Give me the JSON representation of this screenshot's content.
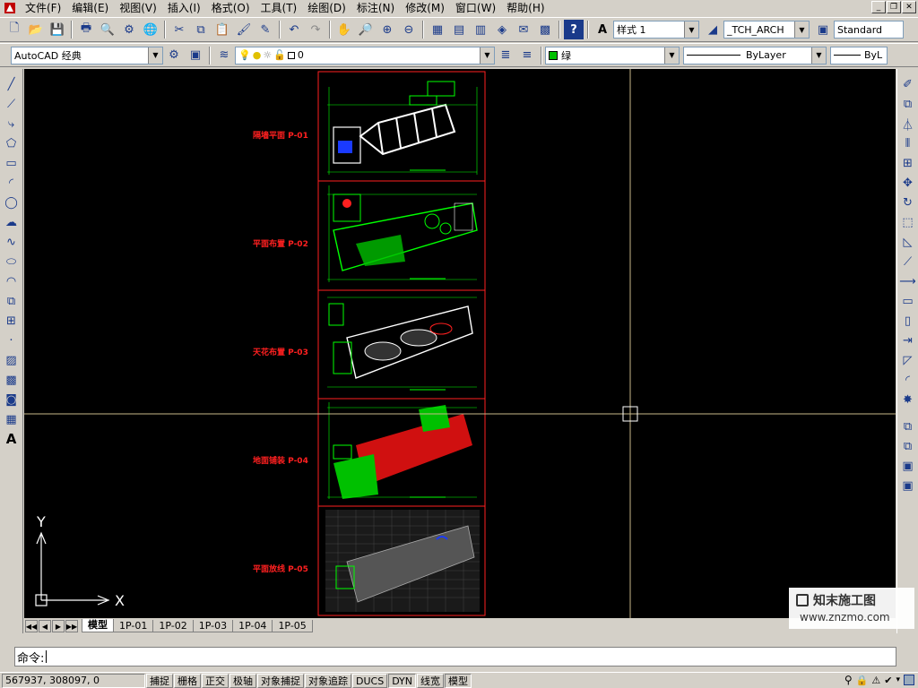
{
  "menu": {
    "items": [
      "文件(F)",
      "编辑(E)",
      "视图(V)",
      "插入(I)",
      "格式(O)",
      "工具(T)",
      "绘图(D)",
      "标注(N)",
      "修改(M)",
      "窗口(W)",
      "帮助(H)"
    ]
  },
  "toolbar1": {
    "text_style_label": "样式 1",
    "dim_style_label": "_TCH_ARCH",
    "table_style_label": "Standard"
  },
  "toolbar2": {
    "workspace": "AutoCAD 经典",
    "layer": "0",
    "color": "绿",
    "linetype": "ByLayer",
    "lineweight": "ByL",
    "colors": {
      "green_swatch": "#00c000"
    }
  },
  "drawing": {
    "sheets": [
      {
        "label": "隔墙平面 P-01"
      },
      {
        "label": "平面布置 P-02"
      },
      {
        "label": "天花布置 P-03"
      },
      {
        "label": "地面铺装 P-04"
      },
      {
        "label": "平面放线 P-05"
      }
    ],
    "ucs": {
      "x": "X",
      "y": "Y"
    }
  },
  "layout_tabs": [
    "模型",
    "1P-01",
    "1P-02",
    "1P-03",
    "1P-04",
    "1P-05"
  ],
  "command": {
    "prompt": "命令:"
  },
  "status": {
    "coords": "567937, 308097, 0",
    "buttons": [
      "捕捉",
      "栅格",
      "正交",
      "极轴",
      "对象捕捉",
      "对象追踪",
      "DUCS",
      "DYN",
      "线宽",
      "模型"
    ]
  },
  "watermark": {
    "line1": "知末施工图",
    "line2": "www.znzmo.com"
  }
}
